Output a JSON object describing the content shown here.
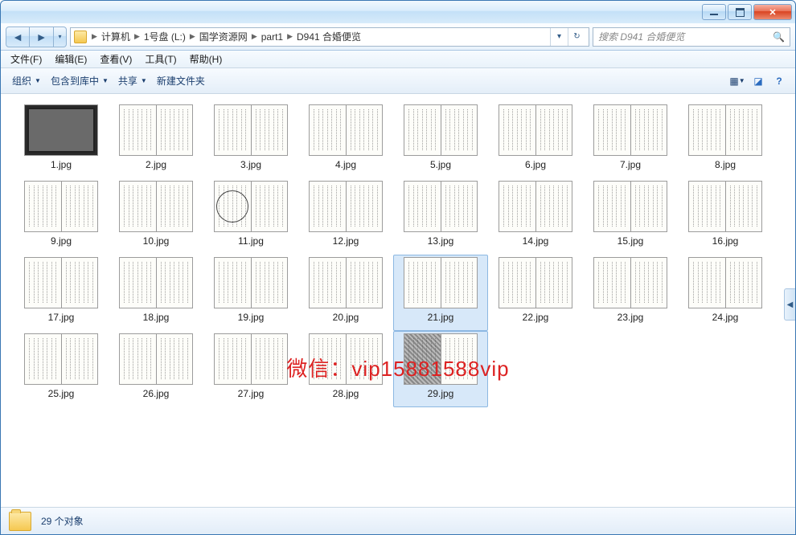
{
  "breadcrumbs": [
    "计算机",
    "1号盘 (L:)",
    "国学资源网",
    "part1",
    "D941 合婚便览"
  ],
  "search_placeholder": "搜索 D941 合婚便览",
  "menus": [
    {
      "key": "file",
      "label": "文件(F)"
    },
    {
      "key": "edit",
      "label": "编辑(E)"
    },
    {
      "key": "view",
      "label": "查看(V)"
    },
    {
      "key": "tools",
      "label": "工具(T)"
    },
    {
      "key": "help",
      "label": "帮助(H)"
    }
  ],
  "toolbar": {
    "organize": "组织",
    "include": "包含到库中",
    "share": "共享",
    "newfolder": "新建文件夹"
  },
  "files": [
    {
      "name": "1.jpg",
      "variant": "cover"
    },
    {
      "name": "2.jpg",
      "variant": "normal"
    },
    {
      "name": "3.jpg",
      "variant": "normal"
    },
    {
      "name": "4.jpg",
      "variant": "normal"
    },
    {
      "name": "5.jpg",
      "variant": "normal"
    },
    {
      "name": "6.jpg",
      "variant": "normal"
    },
    {
      "name": "7.jpg",
      "variant": "normal"
    },
    {
      "name": "8.jpg",
      "variant": "normal"
    },
    {
      "name": "9.jpg",
      "variant": "normal"
    },
    {
      "name": "10.jpg",
      "variant": "normal"
    },
    {
      "name": "11.jpg",
      "variant": "diagram"
    },
    {
      "name": "12.jpg",
      "variant": "normal"
    },
    {
      "name": "13.jpg",
      "variant": "normal"
    },
    {
      "name": "14.jpg",
      "variant": "normal"
    },
    {
      "name": "15.jpg",
      "variant": "normal"
    },
    {
      "name": "16.jpg",
      "variant": "normal"
    },
    {
      "name": "17.jpg",
      "variant": "normal"
    },
    {
      "name": "18.jpg",
      "variant": "normal"
    },
    {
      "name": "19.jpg",
      "variant": "normal"
    },
    {
      "name": "20.jpg",
      "variant": "normal"
    },
    {
      "name": "21.jpg",
      "variant": "normal",
      "selected": true
    },
    {
      "name": "22.jpg",
      "variant": "normal"
    },
    {
      "name": "23.jpg",
      "variant": "normal"
    },
    {
      "name": "24.jpg",
      "variant": "normal"
    },
    {
      "name": "25.jpg",
      "variant": "normal"
    },
    {
      "name": "26.jpg",
      "variant": "normal"
    },
    {
      "name": "27.jpg",
      "variant": "normal"
    },
    {
      "name": "28.jpg",
      "variant": "normal"
    },
    {
      "name": "29.jpg",
      "variant": "dark",
      "selected": true
    }
  ],
  "status": {
    "count_text": "29 个对象"
  },
  "watermark": "微信：vip15881588vip"
}
